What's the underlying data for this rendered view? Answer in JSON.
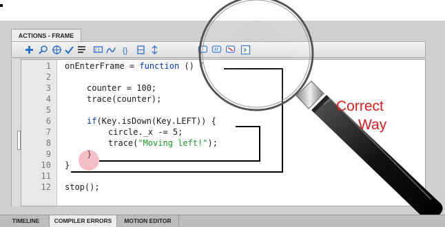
{
  "panel": {
    "actions_tab": "ACTIONS - FRAME"
  },
  "toolbar": {
    "buttons": [
      {
        "icon": "add-statement-icon"
      },
      {
        "icon": "find-icon"
      },
      {
        "icon": "insert-target-path-icon"
      },
      {
        "icon": "check-syntax-icon"
      },
      {
        "icon": "auto-format-icon"
      },
      {
        "icon": "show-code-hint-icon"
      },
      {
        "icon": "debug-options-icon"
      },
      {
        "icon": "collapse-between-braces-icon"
      },
      {
        "icon": "collapse-selection-icon"
      },
      {
        "icon": "expand-all-icon"
      },
      {
        "icon": "apply-block-comment-icon"
      },
      {
        "icon": "apply-line-comment-icon"
      },
      {
        "icon": "remove-comment-icon"
      },
      {
        "icon": "show-hide-toolbox-icon"
      }
    ]
  },
  "editor": {
    "line_numbers": [
      "1",
      "2",
      "3",
      "4",
      "5",
      "6",
      "7",
      "8",
      "9",
      "10",
      "11",
      "12"
    ],
    "lines": {
      "l1_code": "onEnterFrame = ",
      "l1_kw": "function",
      "l1_rest": " () {",
      "l3": "counter = 100;",
      "l4": "trace(counter);",
      "l6_kw": "if",
      "l6_rest": "(Key.isDown(Key.LEFT)) {",
      "l7": "circle._x -= 5;",
      "l8_pre": "trace(",
      "l8_str": "\"Moving left!\"",
      "l8_post": ");",
      "l9": "}",
      "l10": "}",
      "l12": "stop();"
    }
  },
  "bottom_tabs": [
    "TIMELINE",
    "COMPILER ERRORS",
    "MOTION EDITOR"
  ],
  "annotation": {
    "line1": "Correct",
    "line2": "Way"
  },
  "colors": {
    "annotation": "#e31b1b",
    "keyword": "#0033cc",
    "string": "#139c2a"
  }
}
